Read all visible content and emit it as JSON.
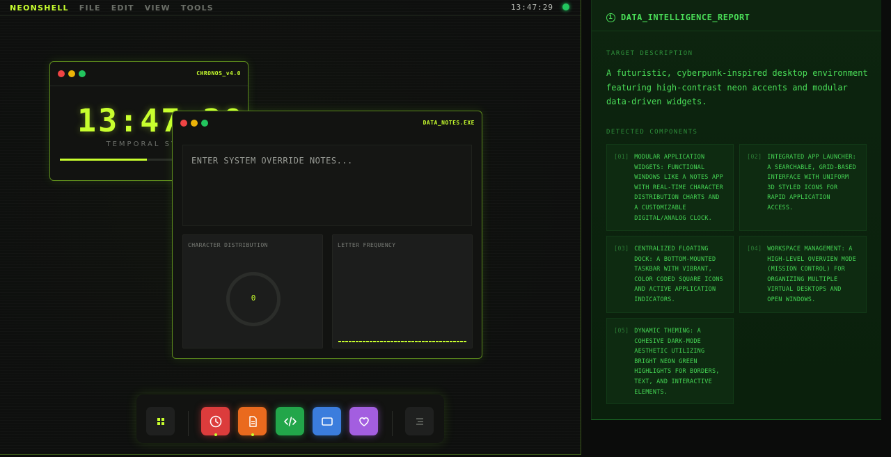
{
  "menubar": {
    "brand": "NEONSHELL",
    "menus": [
      "FILE",
      "EDIT",
      "VIEW",
      "TOOLS"
    ],
    "clock": "13:47:29"
  },
  "chronos": {
    "title": "CHRONOS_v4.0",
    "time": "13:47:29",
    "subtitle": "TEMPORAL SYNC",
    "progress": 0.5
  },
  "notes": {
    "title": "DATA_NOTES.EXE",
    "placeholder": "ENTER SYSTEM OVERRIDE NOTES...",
    "char_dist_label": "CHARACTER DISTRIBUTION",
    "char_count": "0",
    "freq_label": "LETTER FREQUENCY"
  },
  "dock": {
    "items": [
      {
        "name": "launcher",
        "icon": "grid-icon",
        "color": "#1f201f",
        "active": false
      },
      {
        "name": "clock",
        "icon": "clock-icon",
        "color": "#dc3c3c",
        "active": true
      },
      {
        "name": "notes",
        "icon": "document-icon",
        "color": "#ea6a1e",
        "active": true
      },
      {
        "name": "code",
        "icon": "code-icon",
        "color": "#22a64a",
        "active": false
      },
      {
        "name": "display",
        "icon": "window-icon",
        "color": "#3b7ddd",
        "active": false
      },
      {
        "name": "favorites",
        "icon": "heart-icon",
        "color": "#a35ee0",
        "active": false
      },
      {
        "name": "mission-control",
        "icon": "menu-icon",
        "color": "#1f201f",
        "active": false
      }
    ]
  },
  "report": {
    "title": "DATA_INTELLIGENCE_REPORT",
    "target_label": "TARGET DESCRIPTION",
    "description": "A futuristic, cyberpunk-inspired desktop environment featuring high-contrast neon accents and modular data-driven widgets.",
    "components_label": "DETECTED COMPONENTS",
    "components": [
      {
        "num": "[01]",
        "text": "MODULAR APPLICATION WIDGETS: FUNCTIONAL WINDOWS LIKE A NOTES APP WITH REAL-TIME CHARACTER DISTRIBUTION CHARTS AND A CUSTOMIZABLE DIGITAL/ANALOG CLOCK."
      },
      {
        "num": "[02]",
        "text": "INTEGRATED APP LAUNCHER: A SEARCHABLE, GRID-BASED INTERFACE WITH UNIFORM 3D STYLED ICONS FOR RAPID APPLICATION ACCESS."
      },
      {
        "num": "[03]",
        "text": "CENTRALIZED FLOATING DOCK: A BOTTOM-MOUNTED TASKBAR WITH VIBRANT, COLOR CODED SQUARE ICONS AND ACTIVE APPLICATION INDICATORS."
      },
      {
        "num": "[04]",
        "text": "WORKSPACE MANAGEMENT: A HIGH-LEVEL OVERVIEW MODE (MISSION CONTROL) FOR ORGANIZING MULTIPLE VIRTUAL DESKTOPS AND OPEN WINDOWS."
      },
      {
        "num": "[05]",
        "text": "DYNAMIC THEMING: A COHESIVE DARK-MODE AESTHETIC UTILIZING BRIGHT NEON GREEN HIGHLIGHTS FOR BORDERS, TEXT, AND INTERACTIVE ELEMENTS."
      }
    ]
  }
}
